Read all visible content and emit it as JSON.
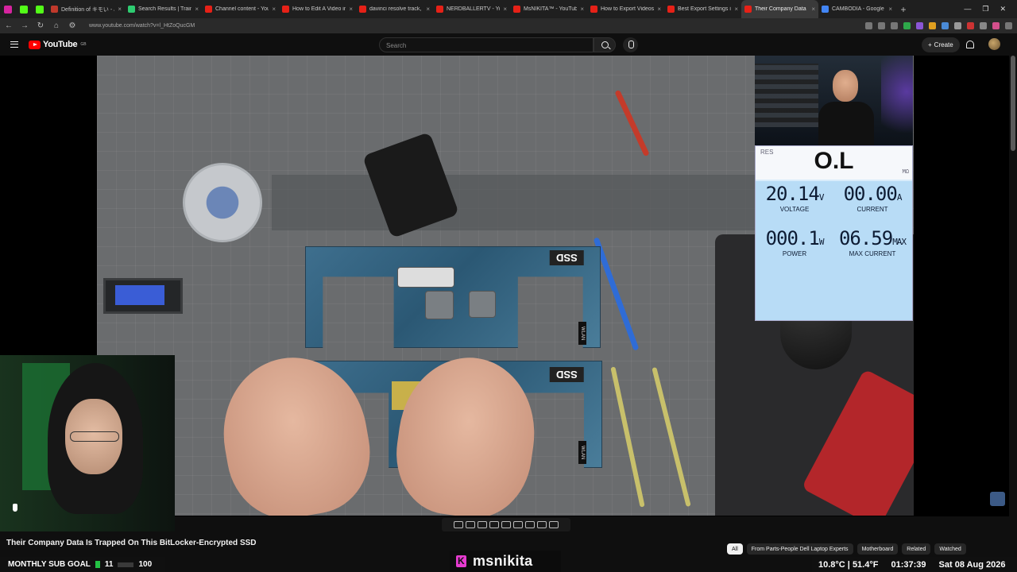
{
  "browser": {
    "tabs": [
      {
        "title": "Definition of キモい - Jap",
        "color": "#c0392b"
      },
      {
        "title": "Search Results | Trainline",
        "color": "#2ecc71"
      },
      {
        "title": "Channel content - YouTub",
        "color": "#e62117"
      },
      {
        "title": "How to Edit A Video in Da",
        "color": "#e62117"
      },
      {
        "title": "davinci resolve track, rem",
        "color": "#e62117"
      },
      {
        "title": "NERDBALLERTV - YouTub",
        "color": "#e62117"
      },
      {
        "title": "MsNIKITA™ - YouTube",
        "color": "#e62117"
      },
      {
        "title": "How to Export Videos wit",
        "color": "#e62117"
      },
      {
        "title": "Best Export Settings in Da",
        "color": "#e62117"
      },
      {
        "title": "Their Company Data",
        "color": "#e62117",
        "active": true
      },
      {
        "title": "CAMBODIA - Google Sea",
        "color": "#4285f4"
      }
    ],
    "url": "www.youtube.com/watch?v=l_HtZoQucGM"
  },
  "youtube": {
    "logo_text": "YouTube",
    "logo_sup": "GB",
    "search_placeholder": "Search",
    "create_label": "Create"
  },
  "meter": {
    "res_label": "RES",
    "ohm_value": "O.L",
    "ohm_unit": "MΩ",
    "voltage": "20.14",
    "voltage_unit": "V",
    "voltage_label": "VOLTAGE",
    "current": "00.00",
    "current_unit": "A",
    "current_label": "CURRENT",
    "power": "000.1",
    "power_unit": "W",
    "power_label": "POWER",
    "max_current": "06.59",
    "max_current_unit": "MAX",
    "max_current_label": "MAX CURRENT"
  },
  "video": {
    "ssd_label": "SSD",
    "wlan_label": "WLAN",
    "title": "Their Company Data Is Trapped On This BitLocker-Encrypted SSD"
  },
  "chips": [
    {
      "label": "All",
      "active": true
    },
    {
      "label": "From Parts-People Dell Laptop Experts"
    },
    {
      "label": "Motherboard"
    },
    {
      "label": "Related"
    },
    {
      "label": "Watched"
    }
  ],
  "overlay": {
    "sub_goal_label": "MONTHLY SUB GOAL",
    "sub_goal_current": "11",
    "sub_goal_target": "100",
    "streamer_name": "msnikita",
    "weather": "10.8°C | 51.4°F",
    "clock": "01:37:39",
    "date": "Sat 08 Aug 2026"
  }
}
